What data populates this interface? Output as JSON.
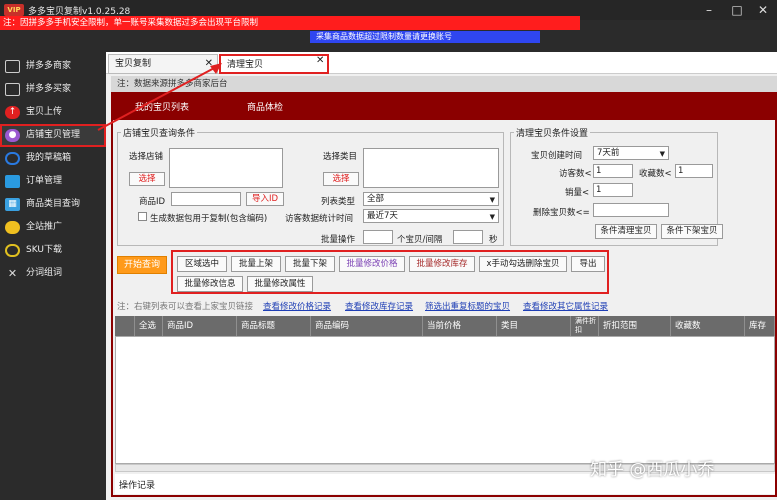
{
  "window": {
    "vip_badge": "VIP",
    "title": "多多宝贝复制v1.0.25.28",
    "notice": "注：因拼多多手机安全限制，单一账号采集数据过多会出现平台限制",
    "notice_blue": "采集商品数据超过限制数量请更换账号"
  },
  "sidebar": {
    "items": [
      {
        "label": "拼多多商家",
        "icon": "monitor-icon",
        "color": "#cccccc"
      },
      {
        "label": "拼多多买家",
        "icon": "monitor-icon",
        "color": "#cccccc"
      },
      {
        "label": "宝贝上传",
        "icon": "cloud-upload-icon",
        "color": "#e02020"
      },
      {
        "label": "店铺宝贝管理",
        "icon": "user-icon",
        "color": "#9b59d0"
      },
      {
        "label": "我的草稿箱",
        "icon": "pie-icon",
        "color": "#2a7ae0"
      },
      {
        "label": "订单管理",
        "icon": "order-icon",
        "color": "#2a9ae0"
      },
      {
        "label": "商品类目查询",
        "icon": "grid-icon",
        "color": "#3aa0e0"
      },
      {
        "label": "全站推广",
        "icon": "promo-icon",
        "color": "#f0c020"
      },
      {
        "label": "SKU下载",
        "icon": "download-icon",
        "color": "#e0c020"
      },
      {
        "label": "分词组词",
        "icon": "tools-icon",
        "color": "#dddddd"
      }
    ]
  },
  "tabs": [
    {
      "label": "宝贝复制"
    },
    {
      "label": "清理宝贝"
    }
  ],
  "note_bar": "注：数据来源拼多多商家后台",
  "subtabs": [
    "我的宝贝列表",
    "商品体检"
  ],
  "query_group": {
    "title": "店铺宝贝查询条件",
    "select_store": "选择店铺",
    "select_btn": "选择",
    "select_category": "选择类目",
    "select_btn2": "选择",
    "product_id": "商品ID",
    "import_id": "导入ID",
    "list_type": "列表类型",
    "list_type_value": "全部",
    "gen_data_checkbox": "生成数据包用于复制(包含编码)",
    "visitor_period": "访客数据统计时间",
    "visitor_period_value": "最近7天",
    "batch_op": "批量操作",
    "per_interval": "个宝贝/间隔",
    "seconds": "秒"
  },
  "clean_group": {
    "title": "清理宝贝条件设置",
    "created_time": "宝贝创建时间",
    "created_time_value": "7天前",
    "visitors": "访客数<",
    "visitors_value": "1",
    "favorites": "收藏数<",
    "favorites_value": "1",
    "sales": "销量<",
    "sales_value": "1",
    "delete_count": "删除宝贝数<=",
    "btn_clean": "条件清理宝贝",
    "btn_delist": "条件下架宝贝"
  },
  "actions": {
    "start_query": "开始查询",
    "buttons": [
      "区域选中",
      "批量上架",
      "批量下架",
      "批量修改价格",
      "批量修改库存",
      "x手动勾选删除宝贝",
      "导出",
      "批量修改信息",
      "批量修改属性"
    ]
  },
  "links": {
    "hint": "注：右键列表可以查看上家宝贝链接",
    "items": [
      "查看修改价格记录",
      "查看修改库存记录",
      "筛选出重复标题的宝贝",
      "查看修改其它属性记录"
    ]
  },
  "table": {
    "columns": [
      "全选",
      "商品ID",
      "商品标题",
      "商品编码",
      "当前价格",
      "类目",
      "满件折扣",
      "折扣范围",
      "收藏数",
      "库存"
    ]
  },
  "log_title": "操作记录",
  "watermark": "知乎 @西瓜小乔",
  "colors": {
    "accent": "#8b0000",
    "highlight": "#e02020",
    "start": "#ff9a1a"
  }
}
